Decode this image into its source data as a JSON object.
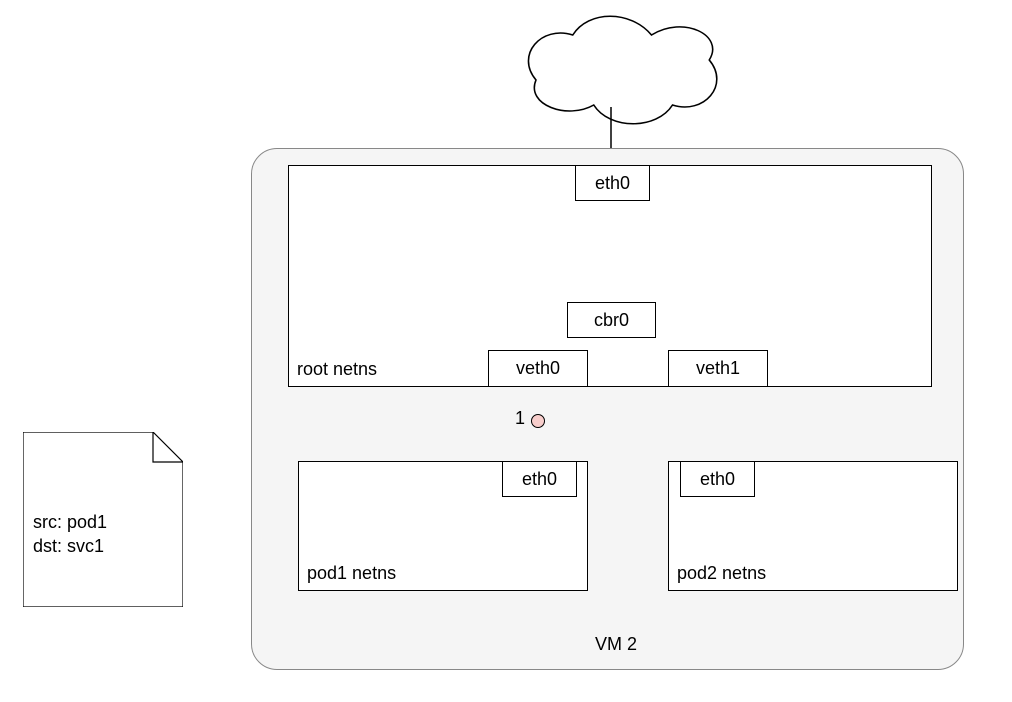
{
  "vm": {
    "label": "VM 2"
  },
  "root_netns": {
    "label": "root netns",
    "eth0": "eth0",
    "cbr0": "cbr0",
    "veth0": "veth0",
    "veth1": "veth1"
  },
  "pod1": {
    "label": "pod1 netns",
    "eth0": "eth0"
  },
  "pod2": {
    "label": "pod2 netns",
    "eth0": "eth0"
  },
  "marker": {
    "num": "1"
  },
  "note": {
    "line1": "src: pod1",
    "line2": "dst: svc1"
  }
}
